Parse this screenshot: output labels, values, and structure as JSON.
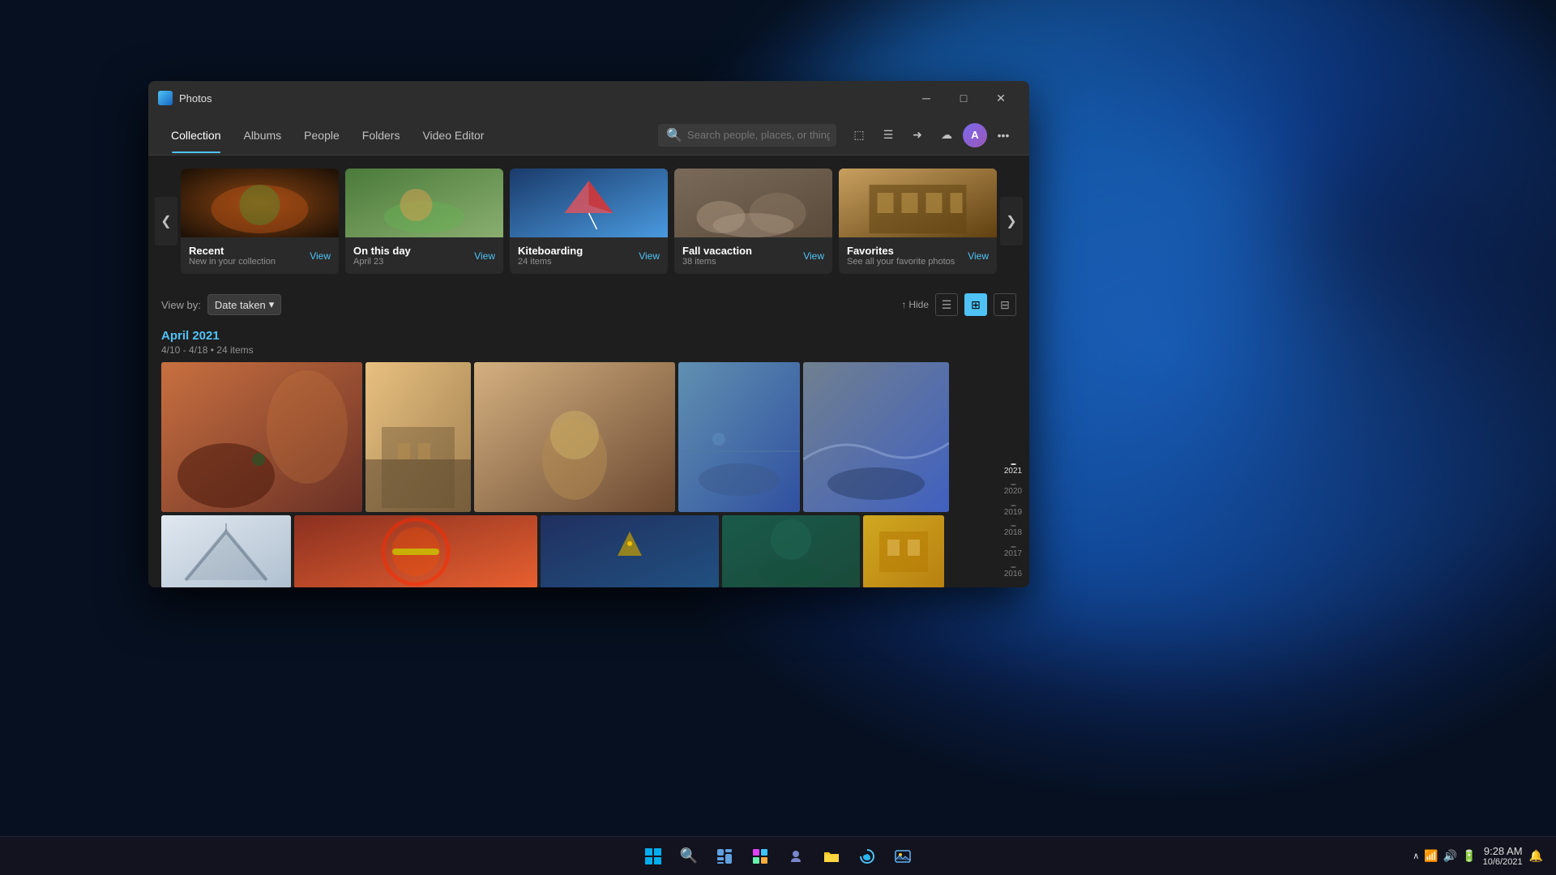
{
  "app": {
    "title": "Photos",
    "icon": "photos-icon"
  },
  "titlebar": {
    "minimize": "─",
    "maximize": "□",
    "close": "✕"
  },
  "nav": {
    "tabs": [
      {
        "id": "collection",
        "label": "Collection",
        "active": true
      },
      {
        "id": "albums",
        "label": "Albums",
        "active": false
      },
      {
        "id": "people",
        "label": "People",
        "active": false
      },
      {
        "id": "folders",
        "label": "Folders",
        "active": false
      },
      {
        "id": "video-editor",
        "label": "Video Editor",
        "active": false
      }
    ],
    "search_placeholder": "Search people, places, or things..."
  },
  "toolbar_icons": {
    "import": "⬚",
    "filter": "☰",
    "slideshow": "➜",
    "cloud": "☁",
    "more": "•••"
  },
  "carousel": {
    "prev_label": "❮",
    "next_label": "❯",
    "cards": [
      {
        "id": "recent",
        "title": "Recent",
        "subtitle": "New in your collection",
        "view_label": "View",
        "theme": "food"
      },
      {
        "id": "on-this-day",
        "title": "On this day",
        "subtitle": "April 23",
        "view_label": "View",
        "theme": "dog"
      },
      {
        "id": "kiteboarding",
        "title": "Kiteboarding",
        "subtitle": "24 items",
        "view_label": "View",
        "theme": "kite"
      },
      {
        "id": "fall-vacation",
        "title": "Fall vacaction",
        "subtitle": "38 items",
        "view_label": "View",
        "theme": "rocks"
      },
      {
        "id": "favorites",
        "title": "Favorites",
        "subtitle": "See all your favorite photos",
        "view_label": "View",
        "theme": "building"
      }
    ]
  },
  "view_controls": {
    "view_by_label": "View by:",
    "date_taken_label": "Date taken",
    "hide_label": "Hide",
    "layout_list": "☰",
    "layout_grid": "⊞",
    "layout_large": "⊟"
  },
  "photo_section": {
    "date": "April 2021",
    "range": "4/10 - 4/18",
    "count": "24 items"
  },
  "timeline": {
    "years": [
      {
        "year": "2021",
        "active": true
      },
      {
        "year": "2020",
        "active": false
      },
      {
        "year": "2019",
        "active": false
      },
      {
        "year": "2018",
        "active": false
      },
      {
        "year": "2017",
        "active": false
      },
      {
        "year": "2016",
        "active": false
      }
    ]
  },
  "taskbar": {
    "start_icon": "⊞",
    "search_icon": "🔍",
    "widgets_icon": "⊡",
    "store_icon": "🏪",
    "teams_icon": "⬡",
    "explorer_icon": "📁",
    "edge_icon": "🌐",
    "photos_icon": "🖼",
    "clock": {
      "time": "9:28 AM",
      "date": "10/6/2021"
    }
  }
}
